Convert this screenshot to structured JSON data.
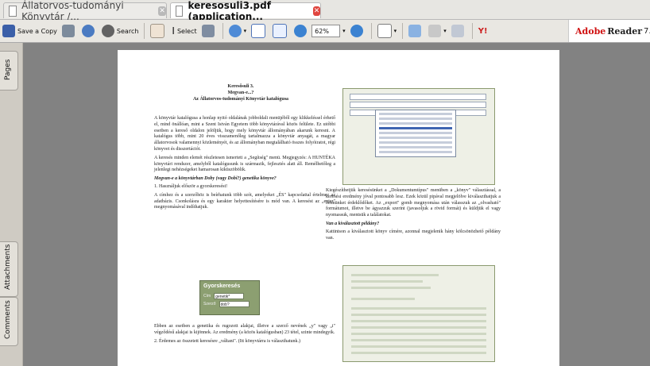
{
  "tabs": [
    {
      "label": "Állatorvos-tudományi Könyvtár /...",
      "active": false
    },
    {
      "label": "keresosuli3.pdf (application...",
      "active": true
    }
  ],
  "toolbar": {
    "save_copy_label": "Save a Copy",
    "search_label": "Search",
    "select_label": "Select",
    "zoom_value": "62%"
  },
  "adobe": {
    "brand": "Adobe",
    "product": "Reader",
    "version": "7."
  },
  "side_tabs": {
    "pages": "Pages",
    "attachments": "Attachments",
    "comments": "Comments"
  },
  "document": {
    "title_lines": [
      "Keresősuli 3.",
      "Megvan-e...?",
      "Az Állatorvos-tudományi Könyvtár katalógusa"
    ],
    "left_paragraphs": [
      "A könyvtár katalógusa a honlap nyitó oldalának jobboldali menüjéből egy klikkeléssel érhető el, mind önállóan, mint a Szent István Egyetem több könyvtárával közös felülete. Ez utóbbi esetben a kereső oldalon jelöljük, hogy mely könyvtár állományában akarunk keresni. A katalógus több, mint 20 éves visszamenőleg tartalmazza a könyvtár anyagát, a magyar állatorvosok valamennyi közleményét, és az állományban megtalálható összes folyóiratot, régi könyvet és disszertációt.",
      "A keresés minden elemét részletesen ismerteti a „Segítség\" menü. Megjegyzés: A HUNTÉKA könyvtári rendszer, amelyből katalógusunk is származik, fejlesztés alatt áll. Remélhetőleg a jelenlegi nehézségeket hamarosan kiküszöbölik."
    ],
    "left_subheading": "Megvan-e a könyvtárban Doby (vagy Dobi?) genetika könyve?",
    "left_paragraphs_2": [
      "1. Használjuk először a gyorskeresést!",
      "A címhez és a szerzőhöz is beírhatunk több szót, amelyeket „ÉS\" kapcsolattal értelmez az adatbázis. Csonkolásra és egy karakter helyettesítésére is mód van. A keresést az „enter\" megnyomásával indíthatjuk."
    ],
    "left_paragraphs_3": [
      "Ebben az esetben a genetika és rugozott alakjai, illetve a szerző nevének „y\" vagy „i\" végződésű alakjai is kijönnek. Az eredmény (a közös katalógusban) 23 tétel, szinte mindegyik.",
      "2. Érdemes az összetett keresésre „váltani\". (Itt könyvtárra is választhatunk.)"
    ],
    "right_paragraphs": [
      "Kiegészíthetjük keresésünket a „Dokumentumtípus\" menüben a „könyv\" választással, a keresési eredmény jóval pontosabb lesz. Ezek közül pipával megjelölve kiválaszthatjuk a bennünket érdeklődőket. Az „export\" gomb megnyomása után válasszuk az „olvasható\" formátumot, illetve be ágyazzuk szerint (javasoljuk a rövid formát) és küldjük el vagy nyomassuk, mentsük a találatokat."
    ],
    "right_subheading": "Van a kiválasztott példány?",
    "right_paragraphs_2": [
      "Kattintson a kiválasztott könyv címére, azonnal megjelenik hány kölcsönözhető példány van."
    ],
    "gyors": {
      "title": "Gyorskeresés",
      "cim_label": "Cím",
      "cim_value": "genetik*",
      "szerzo_label": "Szerző",
      "szerzo_value": "dob?"
    }
  }
}
